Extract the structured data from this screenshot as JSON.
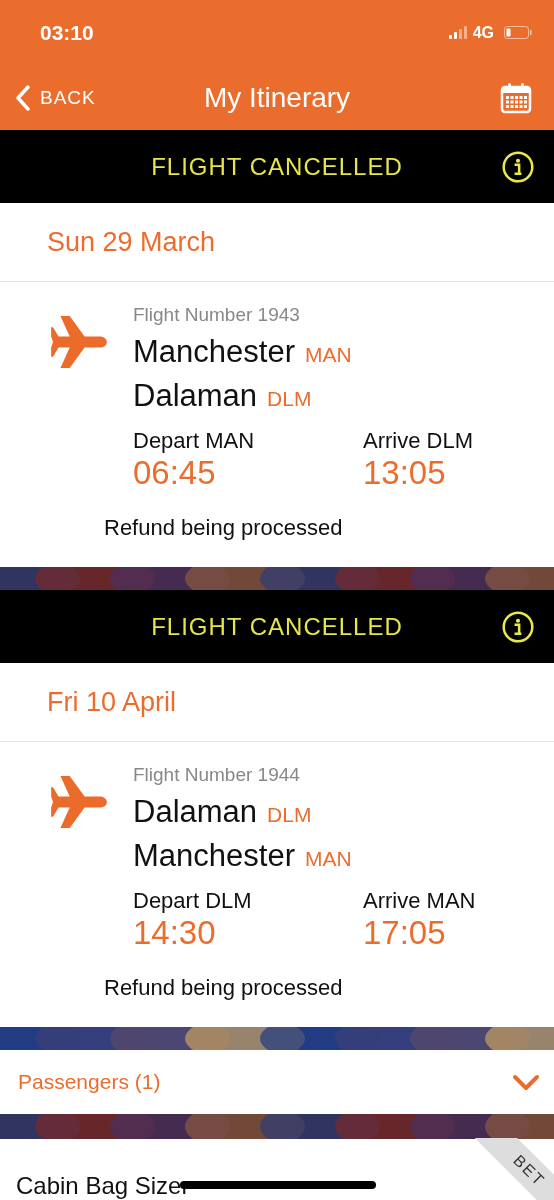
{
  "status_bar": {
    "time": "03:10",
    "network": "4G"
  },
  "nav": {
    "back": "BACK",
    "title": "My Itinerary"
  },
  "flights": [
    {
      "banner": "FLIGHT CANCELLED",
      "date": "Sun 29 March",
      "flight_number": "Flight Number 1943",
      "origin": {
        "city": "Manchester",
        "code": "MAN"
      },
      "destination": {
        "city": "Dalaman",
        "code": "DLM"
      },
      "depart_label": "Depart MAN",
      "depart_time": "06:45",
      "arrive_label": "Arrive DLM",
      "arrive_time": "13:05",
      "status": "Refund being processed"
    },
    {
      "banner": "FLIGHT CANCELLED",
      "date": "Fri 10 April",
      "flight_number": "Flight Number 1944",
      "origin": {
        "city": "Dalaman",
        "code": "DLM"
      },
      "destination": {
        "city": "Manchester",
        "code": "MAN"
      },
      "depart_label": "Depart DLM",
      "depart_time": "14:30",
      "arrive_label": "Arrive MAN",
      "arrive_time": "17:05",
      "status": "Refund being processed"
    }
  ],
  "passengers": {
    "label": "Passengers (1)",
    "expanded": false
  },
  "tools": {
    "label": "Cabin Bag Sizer",
    "ribbon": "BET"
  }
}
